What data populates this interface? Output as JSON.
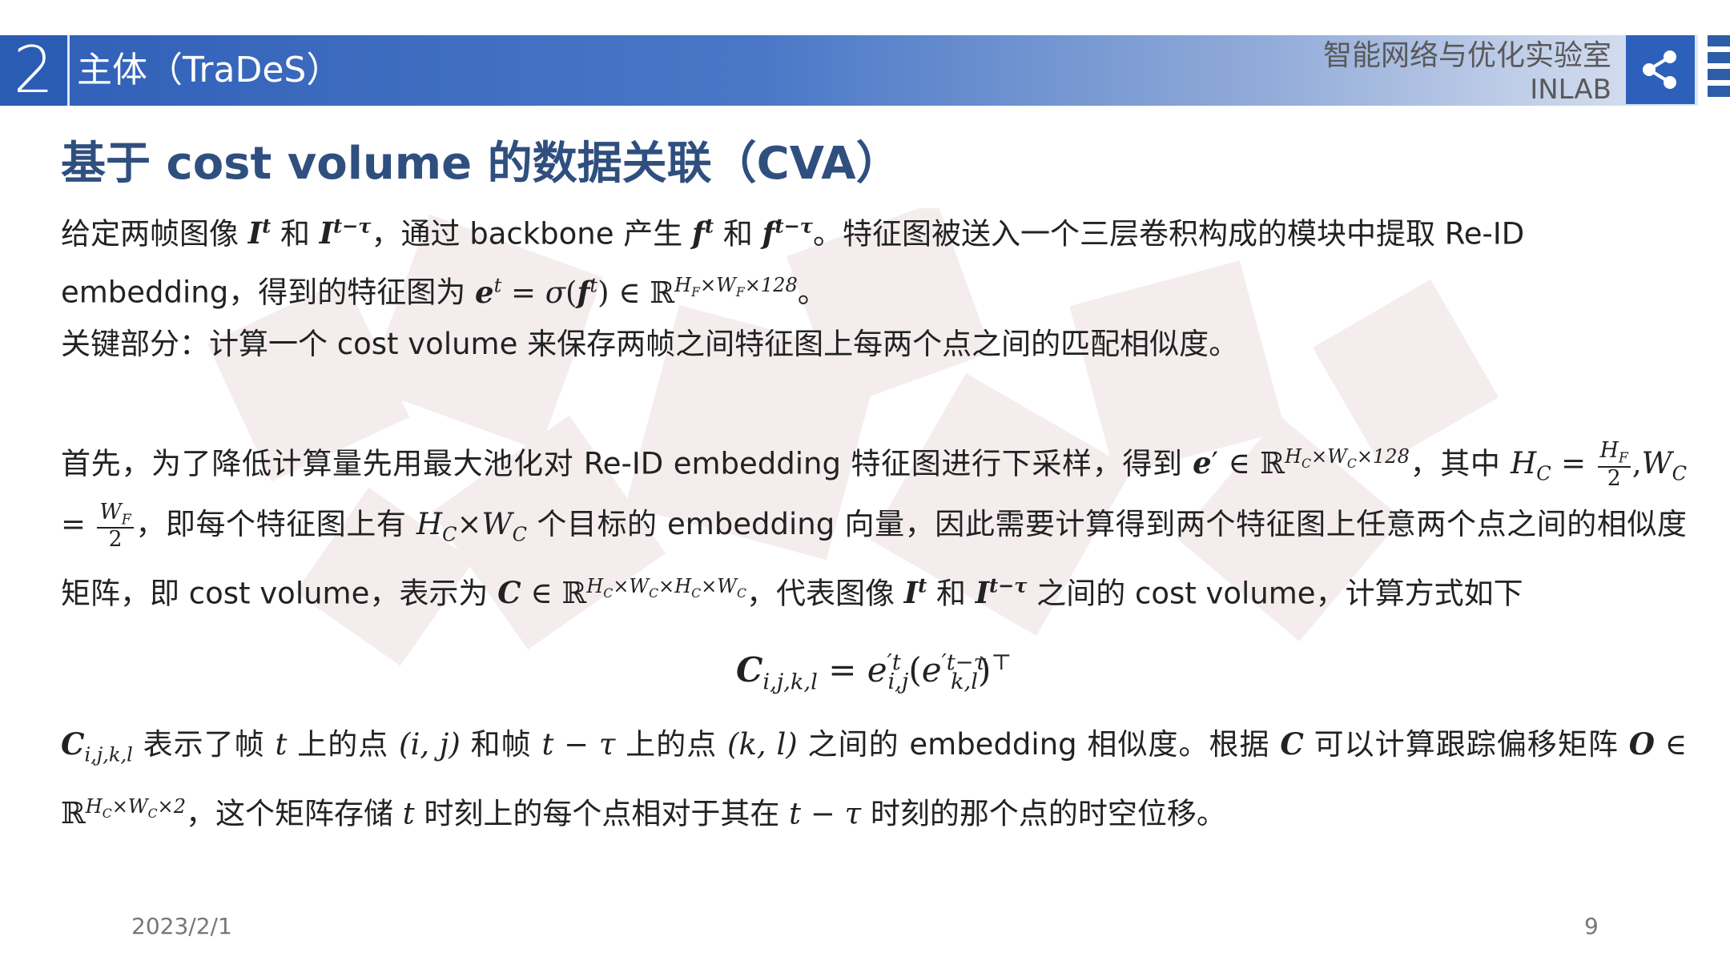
{
  "header": {
    "section_number": "2",
    "section_title": "主体（TraDeS）",
    "lab_name_cn": "智能网络与优化实验室",
    "lab_name_en": "INLAB"
  },
  "slide": {
    "subtitle": "基于 cost volume 的数据关联（CVA）",
    "p1_a": "给定两帧图像",
    "p1_b": "和",
    "p1_c": "，通过 backbone 产生",
    "p1_d": "和",
    "p1_e": "。特征图被送入一个三层卷积构成的模块中提取 Re-ID embedding，得到的特征图为",
    "p1_f": "。",
    "p2": "关键部分：计算一个 cost volume 来保存两帧之间特征图上每两个点之间的匹配相似度。",
    "p3_a": "首先，为了降低计算量先用最大池化对 Re-ID embedding 特征图进行下采样，得到",
    "p3_b": "，其中",
    "p3_c": "，即每个特征图上有",
    "p3_d": "个目标的 embedding 向量，因此需要计算得到两个特征图上任意两个点之间的相似度矩阵，即 cost volume，表示为",
    "p3_e": "，代表图像",
    "p3_f": "和",
    "p3_g": "之间的 cost volume，计算方式如下",
    "p4_a": "表示了帧",
    "p4_b": "上的点",
    "p4_c": "和帧",
    "p4_d": "上的点",
    "p4_e": "之间的 embedding 相似度。根据",
    "p4_f": "可以计算跟踪偏移矩阵",
    "p4_g": "，这个矩阵存储",
    "p4_h": "时刻上的每个点相对于其在",
    "p4_i": "时刻的那个点的时空位移。"
  },
  "footer": {
    "date": "2023/2/1",
    "page": "9"
  },
  "icons": {
    "share": "share-icon"
  },
  "colors": {
    "header_blue": "#2f5fb7",
    "subtitle_blue": "#2f4f7f"
  }
}
